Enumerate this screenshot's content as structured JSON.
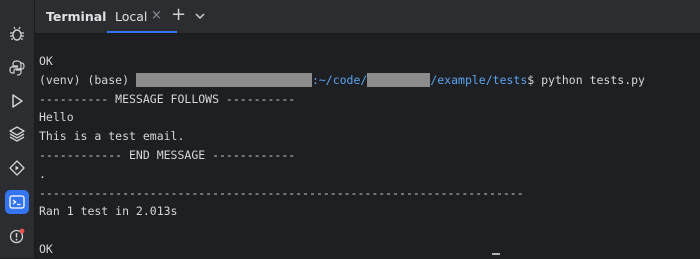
{
  "toolbar": {
    "title": "Terminal",
    "tab": {
      "label": "Local",
      "close": "×"
    },
    "new_tab": "+"
  },
  "sidebar": {
    "items": [
      {
        "icon": "bug-icon"
      },
      {
        "icon": "python-icon"
      },
      {
        "icon": "run-icon"
      },
      {
        "icon": "layers-icon"
      },
      {
        "icon": "services-icon"
      },
      {
        "icon": "terminal-icon",
        "active": true
      },
      {
        "icon": "problems-icon"
      }
    ]
  },
  "terminal": {
    "lines": {
      "ok1": "OK",
      "prompt_prefix": "(venv) (base) ",
      "prompt_path_a": ":~/code/",
      "prompt_path_b": "/example/tests",
      "prompt_cmd": "$ python tests.py",
      "msg_follows": "---------- MESSAGE FOLLOWS ----------",
      "hello": "Hello",
      "test_email": "This is a test email.",
      "end_message": "------------ END MESSAGE ------------",
      "dot": ".",
      "separator": "----------------------------------------------------------------------",
      "ran": "Ran 1 test in 2.013s",
      "ok2": "OK"
    }
  },
  "colors": {
    "accent": "#3574f0",
    "path": "#5aa3f0",
    "background": "#1e1f22"
  }
}
